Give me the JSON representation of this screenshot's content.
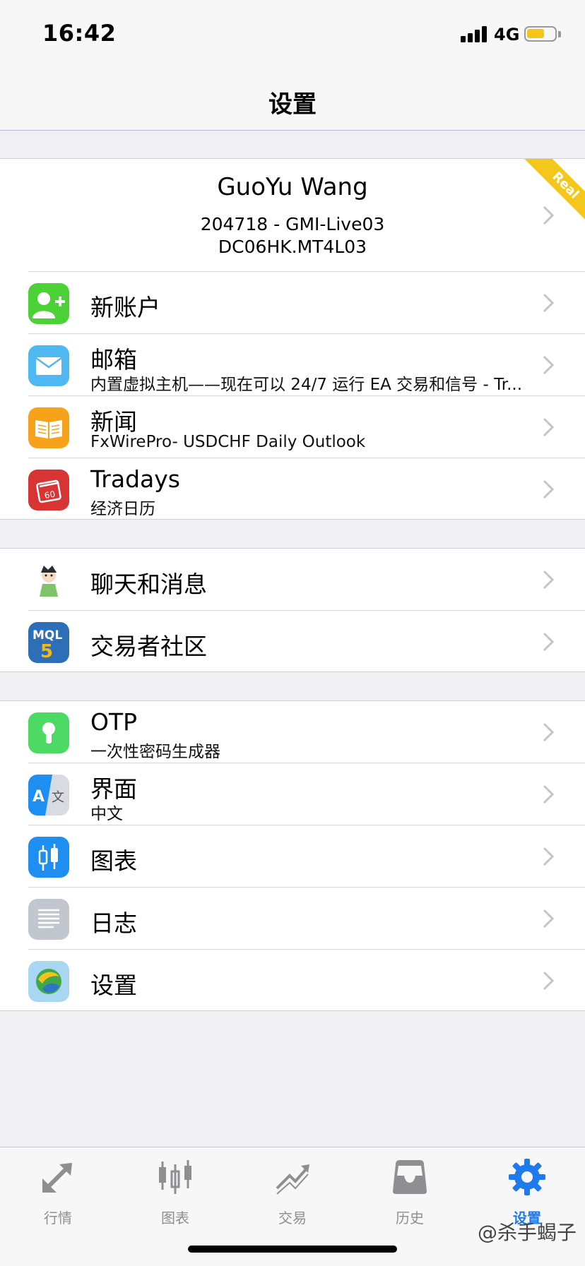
{
  "status_bar": {
    "time": "16:42",
    "network": "4G"
  },
  "nav": {
    "title": "设置"
  },
  "account": {
    "name": "GuoYu Wang",
    "server_line": "204718 - GMI-Live03",
    "host_line": "DC06HK.MT4L03",
    "badge": "Real"
  },
  "group1": {
    "items": [
      {
        "title": "新账户",
        "icon": "add-user-icon"
      },
      {
        "title": "邮箱",
        "subtitle": "内置虚拟主机——现在可以 24/7 运行 EA 交易和信号 - Tr...",
        "icon": "mail-icon"
      },
      {
        "title": "新闻",
        "subtitle": "FxWirePro- USDCHF Daily Outlook",
        "icon": "book-icon"
      },
      {
        "title": "Tradays",
        "subtitle": "经济日历",
        "icon": "calendar-icon"
      }
    ]
  },
  "group2": {
    "items": [
      {
        "title": "聊天和消息",
        "icon": "chat-avatar-icon"
      },
      {
        "title": "交易者社区",
        "icon": "mql5-icon",
        "icon_text": "MQL5"
      }
    ]
  },
  "group3": {
    "items": [
      {
        "title": "OTP",
        "subtitle": "一次性密码生成器",
        "icon": "keyhole-icon"
      },
      {
        "title": "界面",
        "subtitle": "中文",
        "icon": "translate-icon",
        "icon_text_a": "A",
        "icon_text_b": "文"
      },
      {
        "title": "图表",
        "icon": "candlestick-icon"
      },
      {
        "title": "日志",
        "icon": "journal-icon"
      },
      {
        "title": "设置",
        "icon": "metatrader-icon"
      }
    ]
  },
  "tabs": [
    {
      "label": "行情",
      "icon": "quotes-arrows-icon"
    },
    {
      "label": "图表",
      "icon": "chart-candles-icon"
    },
    {
      "label": "交易",
      "icon": "trade-trend-icon"
    },
    {
      "label": "历史",
      "icon": "history-tray-icon"
    },
    {
      "label": "设置",
      "icon": "settings-gear-icon",
      "active": true
    }
  ],
  "watermark": "@杀手蝎子",
  "colors": {
    "accent": "#1f7bec",
    "tab_inactive": "#8e8e93",
    "badge": "#f3c71b",
    "background": "#efeff4"
  }
}
